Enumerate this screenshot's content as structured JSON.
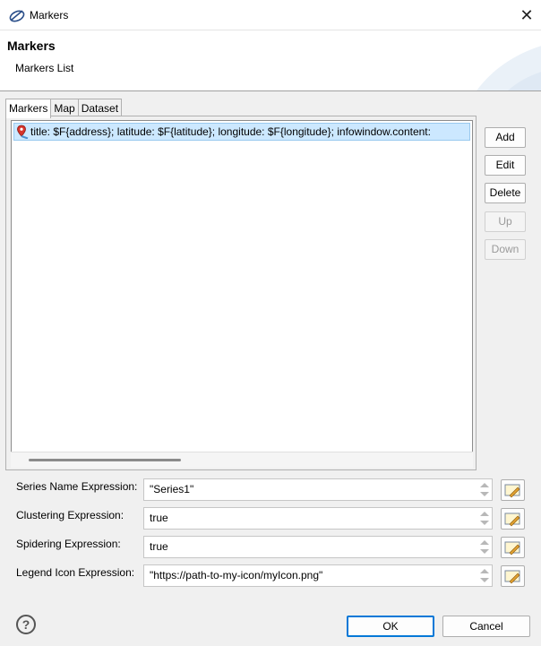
{
  "window": {
    "title": "Markers",
    "close_glyph": "✕"
  },
  "header": {
    "title": "Markers",
    "subtitle": "Markers List"
  },
  "tabs": [
    {
      "label": "Markers",
      "active": true
    },
    {
      "label": "Map",
      "active": false
    },
    {
      "label": "Dataset",
      "active": false
    }
  ],
  "markers_list": {
    "items": [
      {
        "icon": "map-marker-icon",
        "text": "title: $F{address}; latitude: $F{latitude}; longitude: $F{longitude}; infowindow.content:"
      }
    ]
  },
  "side_buttons": {
    "add": "Add",
    "edit": "Edit",
    "delete": "Delete",
    "up": "Up",
    "down": "Down"
  },
  "expressions": {
    "series_name": {
      "label": "Series Name Expression:",
      "value": "\"Series1\""
    },
    "clustering": {
      "label": "Clustering Expression:",
      "value": "true"
    },
    "spidering": {
      "label": "Spidering Expression:",
      "value": "true"
    },
    "legend_icon": {
      "label": "Legend Icon Expression:",
      "value": "\"https://path-to-my-icon/myIcon.png\""
    }
  },
  "footer": {
    "help": "?",
    "ok": "OK",
    "cancel": "Cancel"
  }
}
